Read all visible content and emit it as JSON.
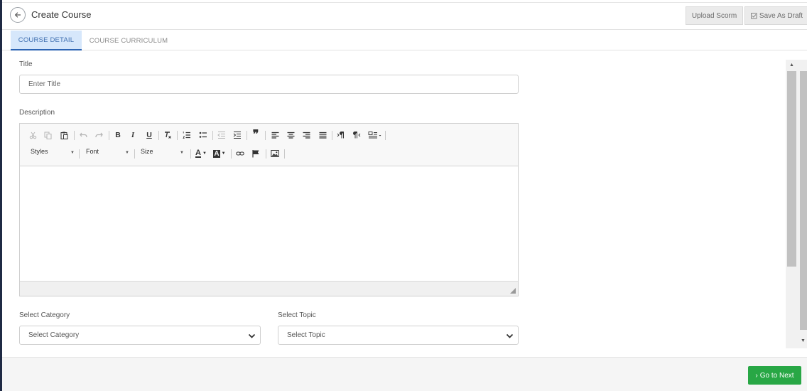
{
  "header": {
    "title": "Create Course",
    "upload_label": "Upload Scorm",
    "draft_label": "Save As Draft"
  },
  "tabs": [
    {
      "label": "COURSE DETAIL",
      "active": true
    },
    {
      "label": "COURSE CURRICULUM",
      "active": false
    }
  ],
  "form": {
    "title_label": "Title",
    "title_placeholder": "Enter Title",
    "description_label": "Description",
    "category_label": "Select Category",
    "category_value": "Select Category",
    "topic_label": "Select Topic",
    "topic_value": "Select Topic"
  },
  "editor": {
    "styles_label": "Styles",
    "font_label": "Font",
    "size_label": "Size",
    "bold": "B",
    "italic": "I",
    "underline": "U",
    "blockquote": "❞",
    "font_color": "A",
    "bg_color": "A"
  },
  "footer": {
    "next_label": "Go to Next"
  },
  "colors": {
    "accent_blue": "#2c64b3",
    "tab_active_bg": "#d6e7fb",
    "next_green": "#28a745"
  }
}
